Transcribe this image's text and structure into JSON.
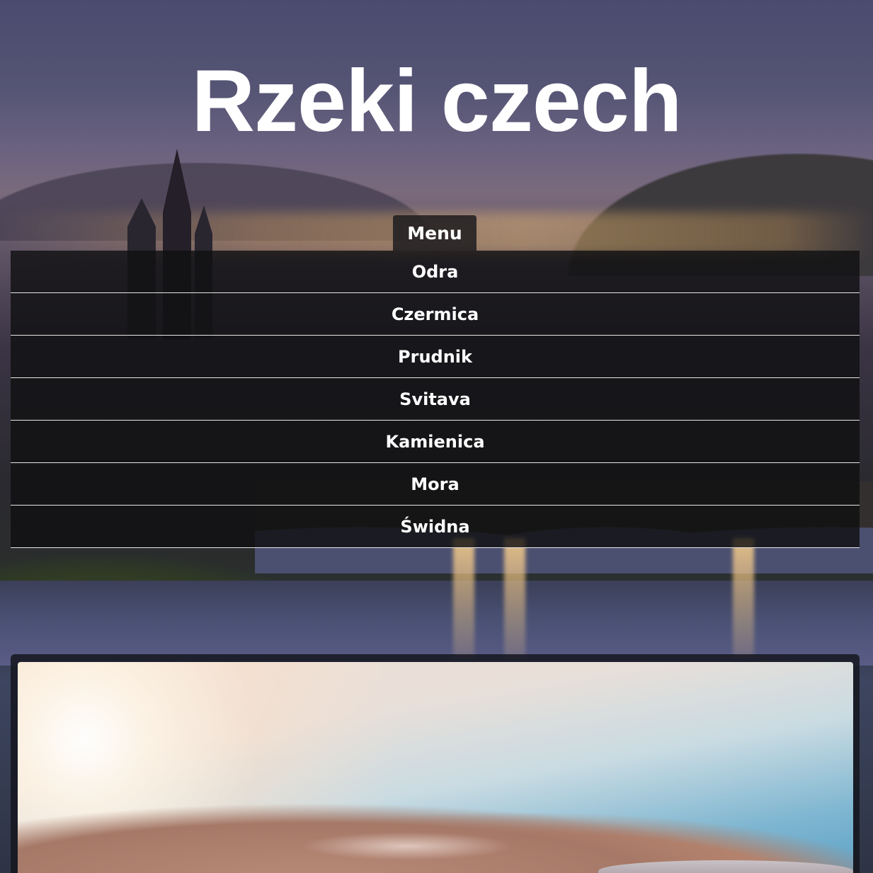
{
  "header": {
    "title": "Rzeki czech"
  },
  "menu": {
    "toggle_label": "Menu",
    "items": [
      {
        "label": "Odra"
      },
      {
        "label": "Czermica"
      },
      {
        "label": "Prudnik"
      },
      {
        "label": "Svitava"
      },
      {
        "label": "Kamienica"
      },
      {
        "label": "Mora"
      },
      {
        "label": "Świdna"
      }
    ]
  },
  "content": {
    "image": "mountain-sunrise-photo"
  }
}
